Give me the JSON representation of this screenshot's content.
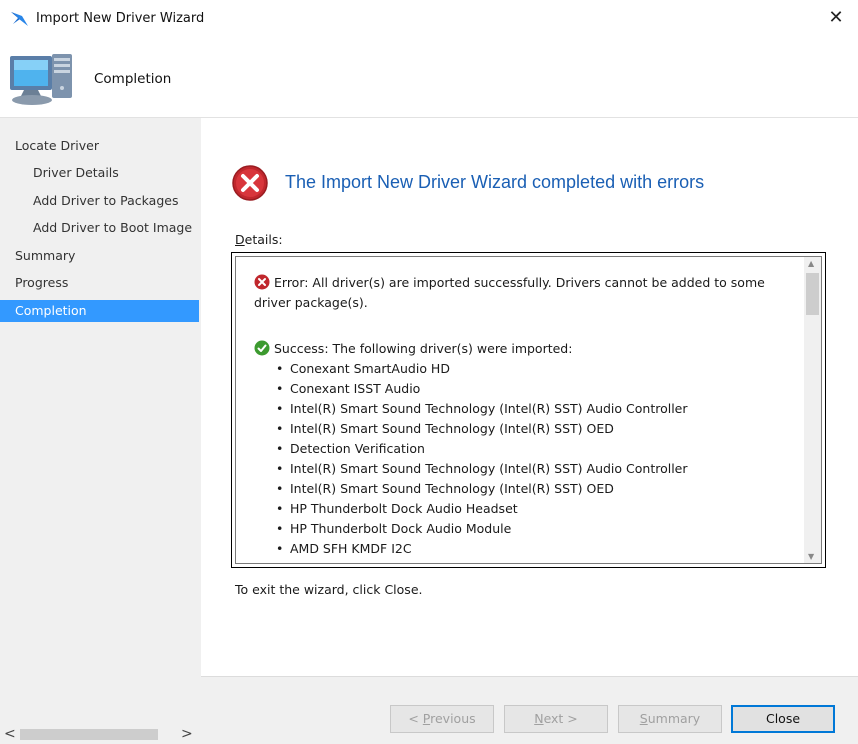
{
  "window": {
    "title": "Import New Driver Wizard",
    "close_glyph": "✕"
  },
  "header": {
    "title": "Completion",
    "icon": "computer-icon"
  },
  "sidebar": {
    "items": [
      {
        "label": "Locate Driver",
        "level": "top",
        "active": false
      },
      {
        "label": "Driver Details",
        "level": "sub",
        "active": false
      },
      {
        "label": "Add Driver to Packages",
        "level": "sub",
        "active": false
      },
      {
        "label": "Add Driver to Boot Image",
        "level": "sub",
        "active": false
      },
      {
        "label": "Summary",
        "level": "top",
        "active": false
      },
      {
        "label": "Progress",
        "level": "top",
        "active": false
      },
      {
        "label": "Completion",
        "level": "top",
        "active": true
      }
    ],
    "scroll_left": "<",
    "scroll_right": ">"
  },
  "main": {
    "result_title": "The Import New Driver Wizard completed with errors",
    "details_label_accel": "D",
    "details_label_rest": "etails:",
    "error_message": "Error: All driver(s) are imported successfully. Drivers cannot be added to some driver package(s).",
    "success_message": "Success: The following driver(s) were imported:",
    "drivers": [
      "Conexant SmartAudio HD",
      "Conexant ISST Audio",
      "Intel(R) Smart Sound Technology (Intel(R) SST) Audio Controller",
      "Intel(R) Smart Sound Technology (Intel(R) SST) OED",
      "Detection Verification",
      "Intel(R) Smart Sound Technology (Intel(R) SST) Audio Controller",
      "Intel(R) Smart Sound Technology (Intel(R) SST) OED",
      "HP Thunderbolt Dock Audio Headset",
      "HP Thunderbolt Dock Audio Module",
      "AMD SFH KMDF I2C"
    ],
    "exit_text": "To exit the wizard, click Close."
  },
  "footer": {
    "previous_prefix": "< ",
    "previous_accel": "P",
    "previous_rest": "revious",
    "next_accel": "N",
    "next_rest": "ext >",
    "summary_accel": "S",
    "summary_rest": "ummary",
    "close_label": "Close"
  },
  "colors": {
    "accent": "#3399ff",
    "title_blue": "#1a5fb4",
    "error_red": "#c0272d",
    "success_green": "#3c9a2f"
  }
}
